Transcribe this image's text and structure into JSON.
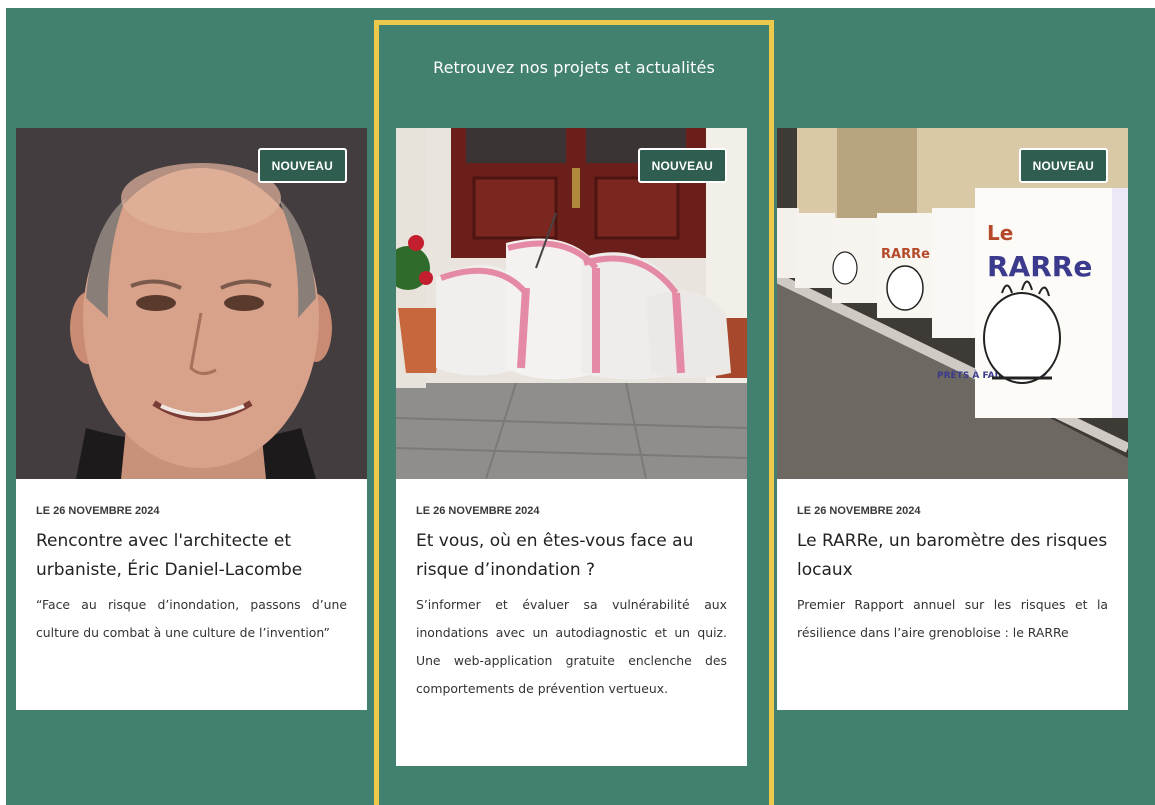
{
  "section": {
    "title": "Retrouvez nos projets et actualités"
  },
  "colors": {
    "background": "#42806f",
    "highlight_border": "#ecc94b",
    "badge_background": "#2f5d4f"
  },
  "cards": [
    {
      "badge": "NOUVEAU",
      "date": "LE 26 NOVEMBRE 2024",
      "title": "Rencontre avec l'architecte et urbaniste, Éric Daniel-Lacombe",
      "excerpt": "“Face au risque d’inondation, passons d’une culture du combat à une culture de l’invention”",
      "image": "portrait-photo"
    },
    {
      "badge": "NOUVEAU",
      "date": "LE 26 NOVEMBRE 2024",
      "title": "Et vous, où en êtes-vous face au risque d’inondation ?",
      "excerpt": "S’informer et évaluer sa vulnérabilité aux inondations avec un autodiagnostic et un quiz. Une web-application gratuite enclenche des comportements de prévention vertueux.",
      "image": "sandbags-door-photo"
    },
    {
      "badge": "NOUVEAU",
      "date": "LE 26 NOVEMBRE 2024",
      "title": "Le RARRe, un baromètre des risques locaux",
      "excerpt": "Premier Rapport annuel sur les risques et la résilience dans l’aire grenobloise : le RARRe",
      "image": "rarre-reports-photo",
      "image_text": {
        "brand_le": "Le",
        "brand_name": "RARRe",
        "small_brand": "RARRe",
        "question": "PRÊTS À FAIRE FACE ?"
      }
    }
  ]
}
